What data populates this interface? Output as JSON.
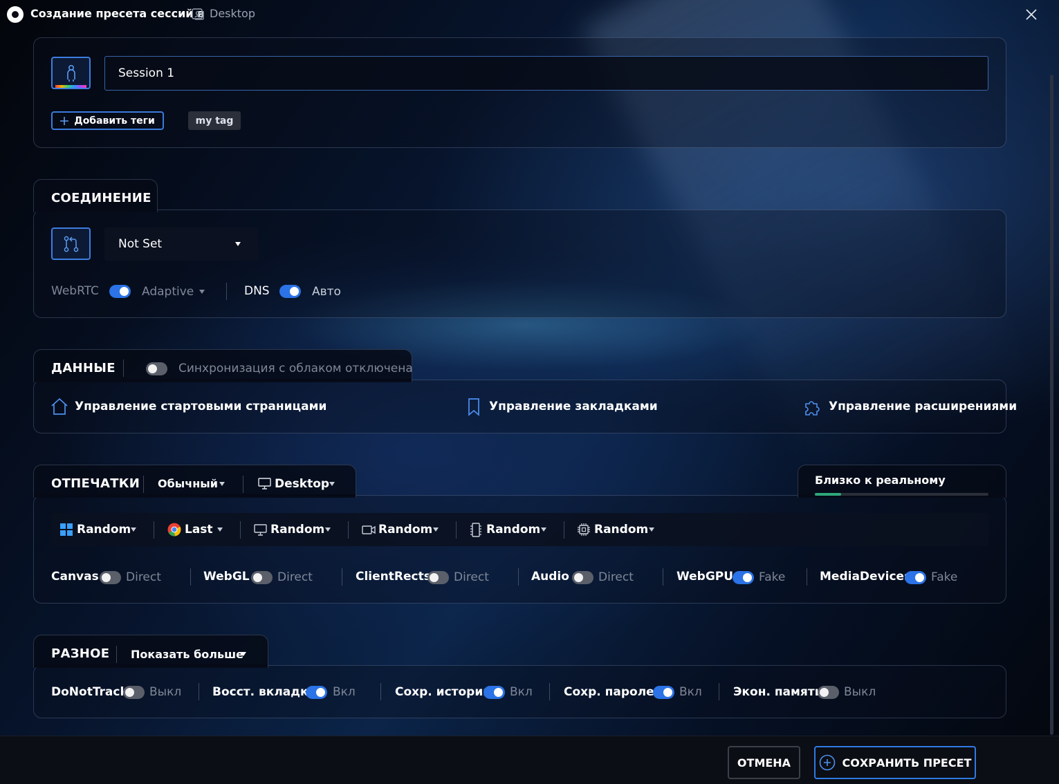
{
  "window": {
    "title": "Создание пресета сессий в",
    "workspace": "Desktop"
  },
  "profile": {
    "session_name": "Session 1",
    "add_tags_label": "Добавить теги",
    "tags": [
      "my tag"
    ]
  },
  "connection": {
    "title": "СОЕДИНЕНИЕ",
    "proxy_value": "Not Set",
    "webrtc_label": "WebRTC",
    "webrtc_enabled": true,
    "webrtc_mode": "Adaptive",
    "dns_label": "DNS",
    "dns_enabled": true,
    "dns_mode": "Авто"
  },
  "data": {
    "title": "ДАННЫЕ",
    "cloud_sync_enabled": false,
    "cloud_sync_label": "Синхронизация с облаком отключена",
    "start_pages_label": "Управление стартовыми страницами",
    "bookmarks_label": "Управление закладками",
    "extensions_label": "Управление расширениями"
  },
  "fingerprints": {
    "title": "ОТПЕЧАТКИ",
    "mode": "Обычный",
    "platform": "Desktop",
    "realism_label": "Близко к реальному",
    "realism_fraction": 0.15,
    "selectors": [
      {
        "icon": "windows-icon",
        "value": "Random"
      },
      {
        "icon": "chrome-icon",
        "value": "Last"
      },
      {
        "icon": "monitor-icon",
        "value": "Random"
      },
      {
        "icon": "camera-icon",
        "value": "Random"
      },
      {
        "icon": "memory-icon",
        "value": "Random"
      },
      {
        "icon": "cpu-icon",
        "value": "Random"
      }
    ],
    "toggles": [
      {
        "label": "Canvas",
        "enabled": false,
        "state": "Direct"
      },
      {
        "label": "WebGL",
        "enabled": false,
        "state": "Direct"
      },
      {
        "label": "ClientRects",
        "enabled": false,
        "state": "Direct"
      },
      {
        "label": "Audio",
        "enabled": false,
        "state": "Direct"
      },
      {
        "label": "WebGPU",
        "enabled": true,
        "state": "Fake"
      },
      {
        "label": "MediaDevices",
        "enabled": true,
        "state": "Fake"
      }
    ]
  },
  "misc": {
    "title": "РАЗНОЕ",
    "show_more_label": "Показать больше",
    "toggles": [
      {
        "label": "DoNotTrack",
        "enabled": false,
        "state": "Выкл"
      },
      {
        "label": "Восст. вкладки",
        "enabled": true,
        "state": "Вкл"
      },
      {
        "label": "Сохр. истории",
        "enabled": true,
        "state": "Вкл"
      },
      {
        "label": "Сохр. паролей",
        "enabled": true,
        "state": "Вкл"
      },
      {
        "label": "Экон. памяти",
        "enabled": false,
        "state": "Выкл"
      }
    ]
  },
  "footer": {
    "cancel_label": "ОТМЕНА",
    "save_label": "СОХРАНИТЬ ПРЕСЕТ"
  },
  "colors": {
    "accent": "#2b73e6",
    "progress": "#2ea77a",
    "toggle_off": "#5a5f6a"
  }
}
